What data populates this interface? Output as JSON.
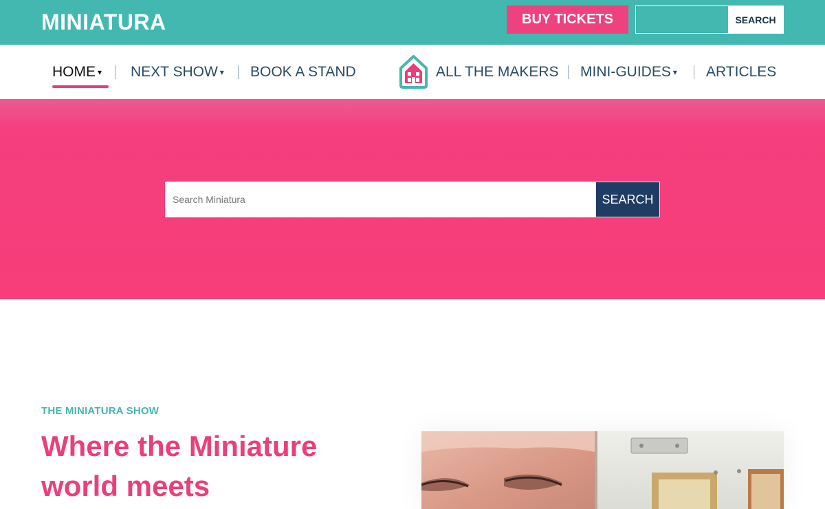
{
  "header": {
    "logo": "MINIATURA",
    "buy_tickets": "BUY TICKETS",
    "search_button": "SEARCH",
    "search_value": ""
  },
  "nav": {
    "items": [
      {
        "label": "HOME",
        "dropdown": true,
        "active": true
      },
      {
        "label": "NEXT SHOW",
        "dropdown": true
      },
      {
        "label": "BOOK A STAND",
        "dropdown": false
      },
      {
        "label": "ALL THE MAKERS",
        "dropdown": false
      },
      {
        "label": "MINI-GUIDES",
        "dropdown": true
      },
      {
        "label": "ARTICLES",
        "dropdown": false
      }
    ],
    "caret": "▾",
    "logo_icon": "house-icon"
  },
  "hero": {
    "search_placeholder": "Search Miniatura",
    "search_button": "SEARCH"
  },
  "intro": {
    "kicker": "THE MINIATURA SHOW",
    "headline": "Where the Miniature world meets"
  },
  "colors": {
    "teal": "#42b8b0",
    "pink": "#f0417f",
    "navy": "#1f3c63",
    "headline_pink": "#ea3f7a"
  }
}
